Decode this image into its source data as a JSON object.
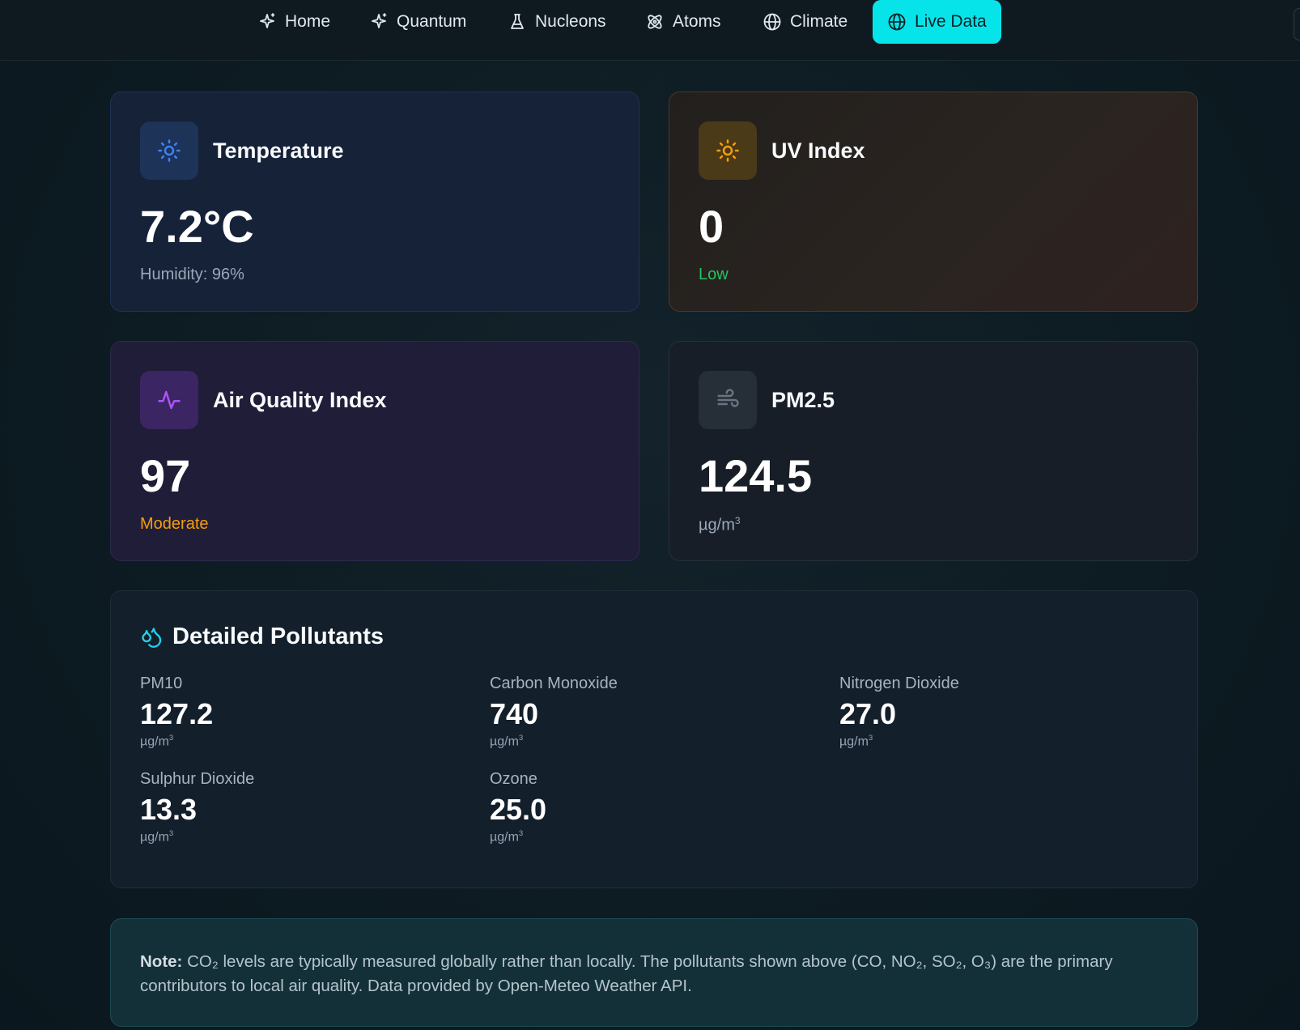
{
  "nav": {
    "items": [
      {
        "label": "Home",
        "icon": "sparkle-icon"
      },
      {
        "label": "Quantum",
        "icon": "sparkle-icon"
      },
      {
        "label": "Nucleons",
        "icon": "flask-icon"
      },
      {
        "label": "Atoms",
        "icon": "atom-icon"
      },
      {
        "label": "Climate",
        "icon": "globe-icon"
      },
      {
        "label": "Live Data",
        "icon": "globe-icon",
        "active": true
      }
    ]
  },
  "cards": {
    "temperature": {
      "title": "Temperature",
      "value": "7.2°C",
      "sub": "Humidity: 96%",
      "icon": "sun-icon",
      "color": "#3b82f6"
    },
    "uv": {
      "title": "UV Index",
      "value": "0",
      "sub": "Low",
      "icon": "sun-icon",
      "color": "#f59e0b",
      "sub_color": "#22c55e"
    },
    "aqi": {
      "title": "Air Quality Index",
      "value": "97",
      "sub": "Moderate",
      "icon": "activity-icon",
      "color": "#a855f7",
      "sub_color": "#f59e0b"
    },
    "pm25": {
      "title": "PM2.5",
      "value": "124.5",
      "unit": "µg/m",
      "unit_sup": "3",
      "icon": "wind-icon",
      "color": "#6b7280"
    }
  },
  "pollutants": {
    "title": "Detailed Pollutants",
    "icon": "droplets-icon",
    "items": [
      {
        "label": "PM10",
        "value": "127.2",
        "unit": "µg/m",
        "unit_sup": "3"
      },
      {
        "label": "Carbon Monoxide",
        "value": "740",
        "unit": "µg/m",
        "unit_sup": "3"
      },
      {
        "label": "Nitrogen Dioxide",
        "value": "27.0",
        "unit": "µg/m",
        "unit_sup": "3"
      },
      {
        "label": "Sulphur Dioxide",
        "value": "13.3",
        "unit": "µg/m",
        "unit_sup": "3"
      },
      {
        "label": "Ozone",
        "value": "25.0",
        "unit": "µg/m",
        "unit_sup": "3"
      }
    ]
  },
  "note": {
    "label": "Note:",
    "text": "CO₂ levels are typically measured globally rather than locally. The pollutants shown above (CO, NO₂, SO₂, O₃) are the primary contributors to local air quality. Data provided by Open-Meteo Weather API."
  },
  "colors": {
    "accent": "#06e4ea"
  }
}
